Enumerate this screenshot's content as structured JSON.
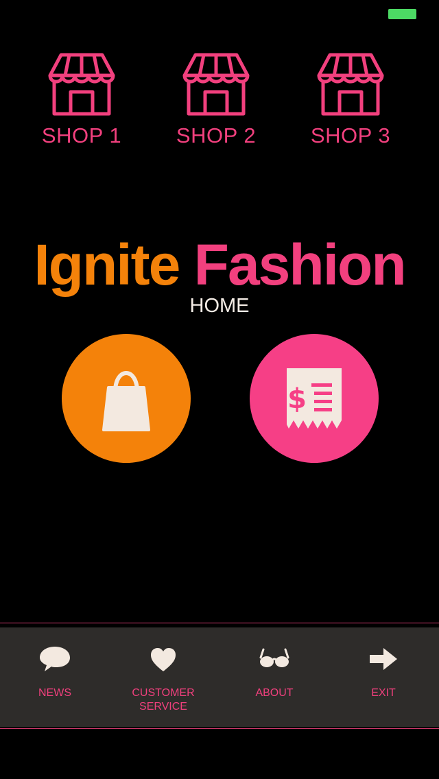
{
  "colors": {
    "background": "#000000",
    "accent_pink": "#f2407e",
    "accent_orange": "#f4820a",
    "battery_green": "#4cd964",
    "tabbar_bg": "#2e2c2a",
    "icon_light": "#f3e9e0"
  },
  "shops": [
    {
      "label": "SHOP 1",
      "icon": "store-icon"
    },
    {
      "label": "SHOP 2",
      "icon": "store-icon"
    },
    {
      "label": "SHOP 3",
      "icon": "store-icon"
    }
  ],
  "brand": {
    "part1": "Ignite",
    "part2": "Fashion"
  },
  "page": {
    "title": "HOME"
  },
  "actions": [
    {
      "icon": "shopping-bag-icon",
      "color": "#f4820a"
    },
    {
      "icon": "receipt-icon",
      "color": "#f63f86"
    }
  ],
  "tabbar": {
    "items": [
      {
        "label": "NEWS",
        "icon": "speech-bubble-icon"
      },
      {
        "label": "CUSTOMER SERVICE",
        "icon": "heart-icon"
      },
      {
        "label": "ABOUT",
        "icon": "glasses-icon"
      },
      {
        "label": "EXIT",
        "icon": "arrow-right-icon"
      }
    ]
  }
}
